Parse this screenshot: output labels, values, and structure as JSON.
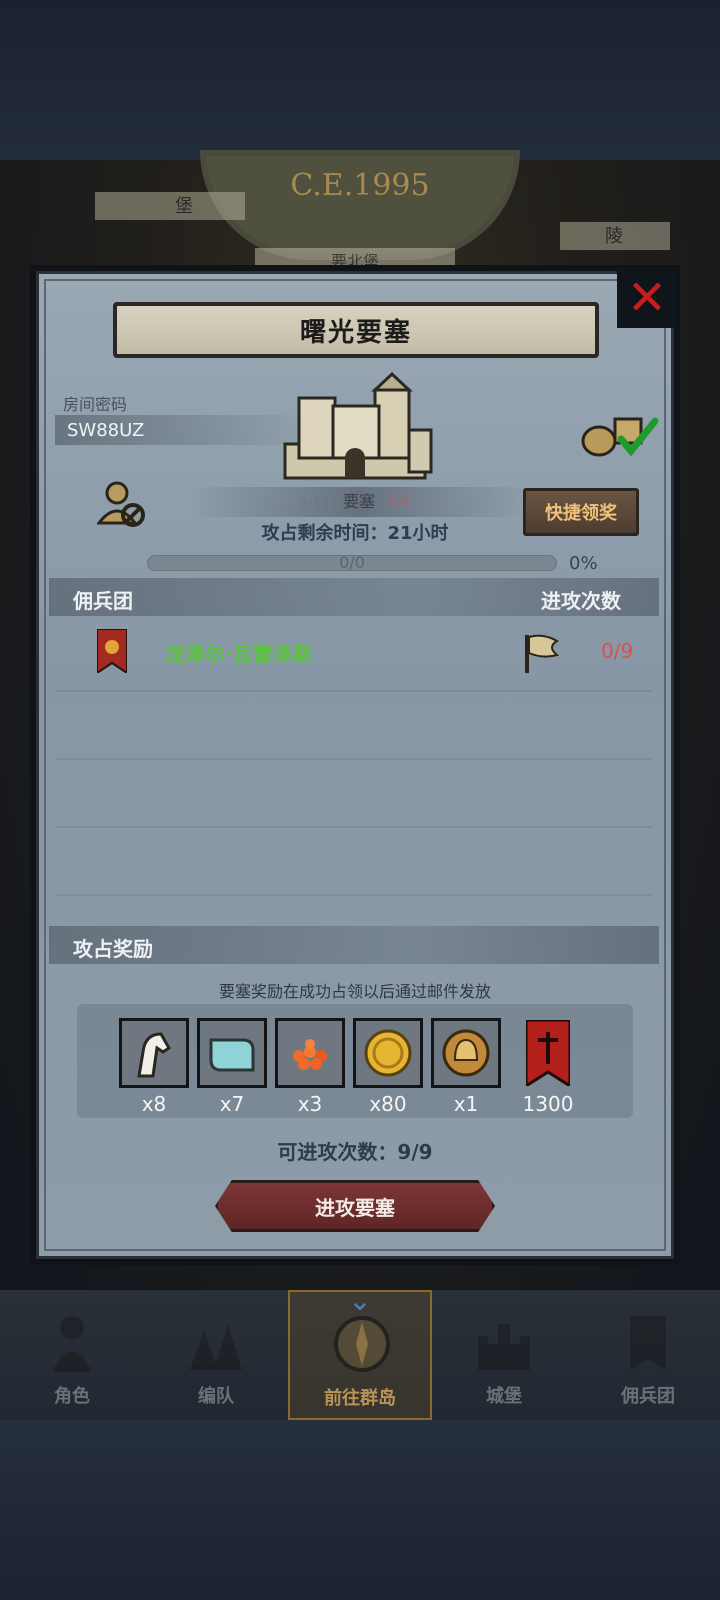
{
  "background": {
    "era": "C.E.1995",
    "label_left": "堡",
    "label_right": "陵",
    "label_center": "要北堡"
  },
  "modal": {
    "title": "曙光要塞",
    "room_label": "房间密码",
    "room_code": "SW88UZ",
    "fortress_name": "要塞",
    "fortress_faded_1": "木材",
    "fortress_faded_2": "64",
    "quick_claim_label": "快捷领奖",
    "time_left": "攻占剩余时间：21小时",
    "progress": {
      "text": "0/0",
      "percent_label": "0%",
      "fraction": 0
    },
    "mercenary_header": "佣兵团",
    "attacks_header": "进攻次数",
    "mercenary": {
      "name": "龙泽尔·瓦雷泽斯",
      "attacks": "0/9"
    },
    "rewards_header": "攻占奖励",
    "reward_note": "要塞奖励在成功占领以后通过邮件发放",
    "rewards": [
      {
        "icon": "horse-icon",
        "count": "x8"
      },
      {
        "icon": "cloth-icon",
        "count": "x7"
      },
      {
        "icon": "roe-icon",
        "count": "x3"
      },
      {
        "icon": "gold-coin-icon",
        "count": "x80"
      },
      {
        "icon": "helmet-coin-icon",
        "count": "x1"
      },
      {
        "icon": "banner-icon",
        "count": "1300"
      }
    ],
    "attempts": "可进攻次数：9/9",
    "attack_button": "进攻要塞"
  },
  "nav": {
    "items": [
      {
        "label": "角色",
        "icon": "knight-icon"
      },
      {
        "label": "编队",
        "icon": "troops-icon"
      },
      {
        "label": "前往群岛",
        "icon": "compass-icon",
        "active": true
      },
      {
        "label": "城堡",
        "icon": "castle-icon"
      },
      {
        "label": "佣兵团",
        "icon": "mercenary-icon"
      }
    ]
  },
  "colors": {
    "accent_red": "#c81d1d",
    "mercenary_green": "#5ac43c",
    "quick_btn_text": "#f2c27a"
  }
}
